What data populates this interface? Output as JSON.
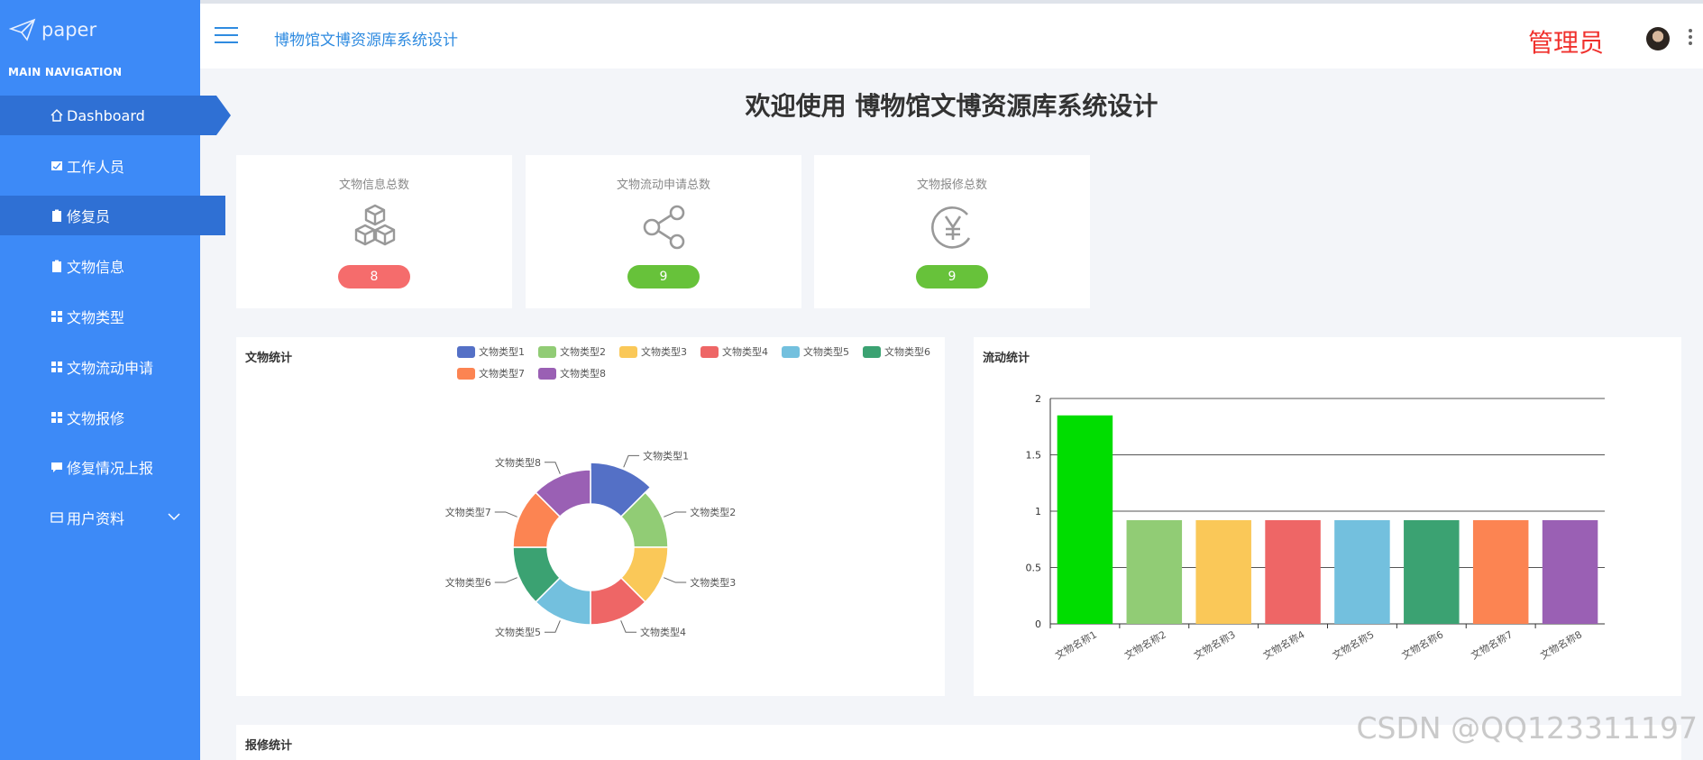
{
  "sidebar": {
    "logo_text": "paper",
    "section_label": "MAIN NAVIGATION",
    "items": [
      {
        "label": "Dashboard",
        "icon": "home-icon"
      },
      {
        "label": "工作人员",
        "icon": "user-card-icon"
      },
      {
        "label": "修复员",
        "icon": "clipboard-icon"
      },
      {
        "label": "文物信息",
        "icon": "clipboard-icon"
      },
      {
        "label": "文物类型",
        "icon": "grid-icon"
      },
      {
        "label": "文物流动申请",
        "icon": "grid-icon"
      },
      {
        "label": "文物报修",
        "icon": "grid-icon"
      },
      {
        "label": "修复情况上报",
        "icon": "message-icon"
      },
      {
        "label": "用户资料",
        "icon": "id-card-icon"
      }
    ]
  },
  "header": {
    "title": "博物馆文博资源库系统设计",
    "user_role": "管理员"
  },
  "welcome": "欢迎使用 博物馆文博资源库系统设计",
  "stats": [
    {
      "label": "文物信息总数",
      "value": "8",
      "color": "#f56c6c",
      "icon": "cubes-icon"
    },
    {
      "label": "文物流动申请总数",
      "value": "9",
      "color": "#67c23a",
      "icon": "share-icon"
    },
    {
      "label": "文物报修总数",
      "value": "9",
      "color": "#67c23a",
      "icon": "yuan-icon"
    }
  ],
  "panels": {
    "pie_title": "文物统计",
    "bar_title": "流动统计",
    "repair_title": "报修统计"
  },
  "chart_data": [
    {
      "type": "pie",
      "title": "文物统计",
      "categories": [
        "文物类型1",
        "文物类型2",
        "文物类型3",
        "文物类型4",
        "文物类型5",
        "文物类型6",
        "文物类型7",
        "文物类型8"
      ],
      "values": [
        1,
        1,
        1,
        1,
        1,
        1,
        1,
        1
      ],
      "colors": [
        "#5470c6",
        "#91cc75",
        "#fac858",
        "#ee6666",
        "#73c0de",
        "#3ba272",
        "#fc8452",
        "#9a60b4"
      ]
    },
    {
      "type": "bar",
      "title": "流动统计",
      "categories": [
        "文物名称1",
        "文物名称2",
        "文物名称3",
        "文物名称4",
        "文物名称5",
        "文物名称6",
        "文物名称7",
        "文物名称8"
      ],
      "values": [
        2,
        1,
        1,
        1,
        1,
        1,
        1,
        1
      ],
      "ylim": [
        0,
        2
      ],
      "yticks": [
        "0",
        "0.5",
        "1",
        "1.5",
        "2"
      ],
      "colors": [
        "#00dd00",
        "#91cc75",
        "#fac858",
        "#ee6666",
        "#73c0de",
        "#3ba272",
        "#fc8452",
        "#9a60b4"
      ]
    }
  ],
  "watermark": "CSDN @QQ123311197"
}
